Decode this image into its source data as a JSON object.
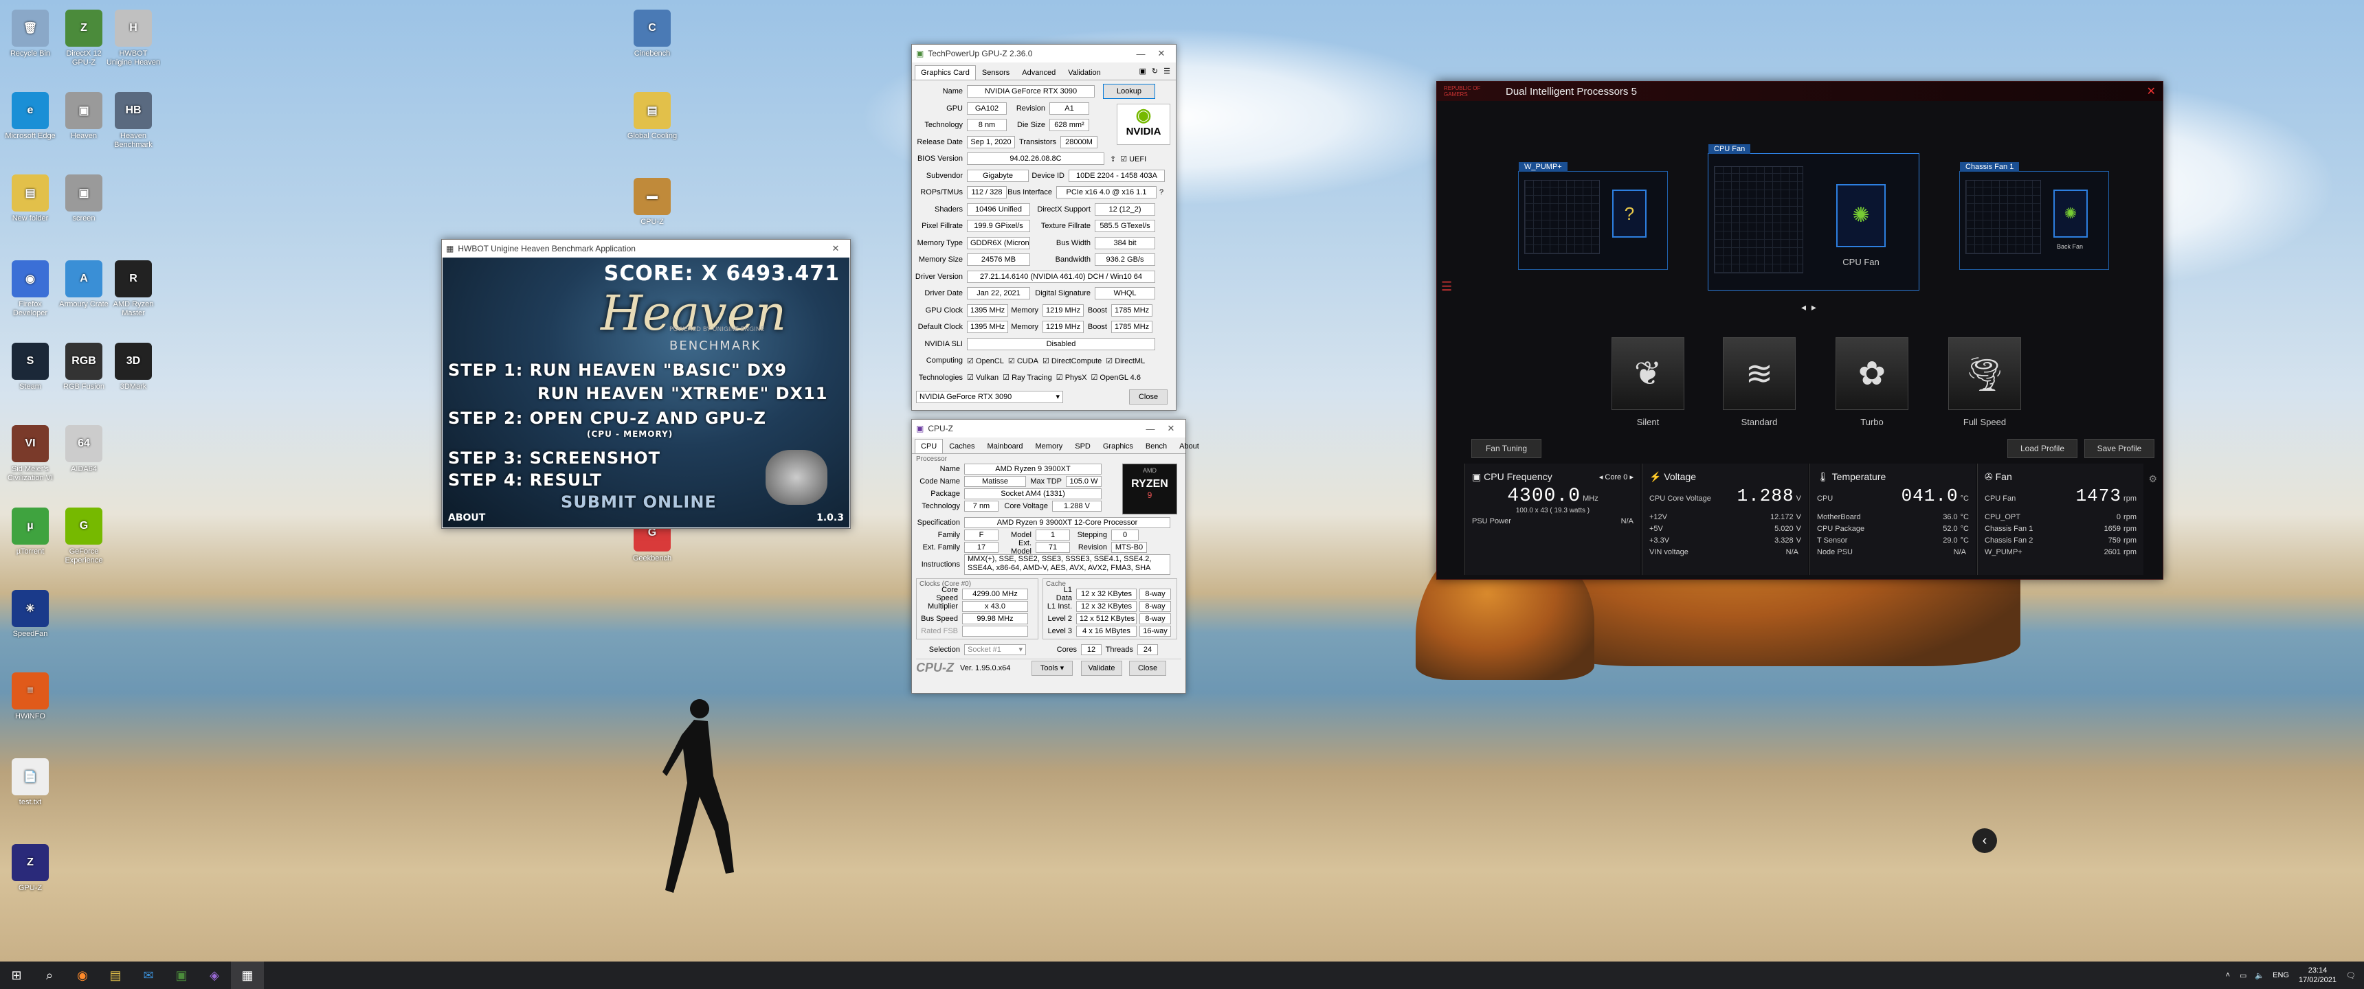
{
  "desktop": {
    "icons": [
      {
        "label": "Recycle Bin",
        "color": "#8aa8c8",
        "glyph": "🗑"
      },
      {
        "label": "DirectX 12 GPU-Z",
        "color": "#4b8b3b",
        "glyph": "Z"
      },
      {
        "label": "HWBOT Unigine Heaven",
        "color": "#c0c0c0",
        "glyph": "H"
      },
      {
        "label": "Microsoft Edge",
        "color": "#1a8fd6",
        "glyph": "e"
      },
      {
        "label": "Heaven",
        "color": "#9a9a9a",
        "glyph": "▣"
      },
      {
        "label": "Heaven Benchmark",
        "color": "#5a6a80",
        "glyph": "HB"
      },
      {
        "label": "New folder",
        "color": "#e2c04a",
        "glyph": "▤"
      },
      {
        "label": "screen",
        "color": "#9a9a9a",
        "glyph": "▣"
      },
      {
        "label": "Firefox Developer",
        "color": "#3b6fd6",
        "glyph": "◉"
      },
      {
        "label": "Armoury Crate",
        "color": "#3a8fd6",
        "glyph": "A"
      },
      {
        "label": "AMD Ryzen Master",
        "color": "#222",
        "glyph": "R"
      },
      {
        "label": "Steam",
        "color": "#1b2838",
        "glyph": "S"
      },
      {
        "label": "RGB Fusion",
        "color": "#333",
        "glyph": "RGB"
      },
      {
        "label": "3DMark",
        "color": "#222",
        "glyph": "3D"
      },
      {
        "label": "Sid Meier's Civilization VI",
        "color": "#7a3a2a",
        "glyph": "VI"
      },
      {
        "label": "AIDA64",
        "color": "#ccc",
        "glyph": "64"
      },
      {
        "label": "µTorrent",
        "color": "#3fa33f",
        "glyph": "µ"
      },
      {
        "label": "GeForce Experience",
        "color": "#76b900",
        "glyph": "G"
      },
      {
        "label": "SpeedFan",
        "color": "#1a3a8a",
        "glyph": "✳"
      },
      {
        "label": "HWiNFO",
        "color": "#e05a1a",
        "glyph": "≡"
      },
      {
        "label": "test.txt",
        "color": "#eee",
        "glyph": "📄"
      },
      {
        "label": "GPU-Z",
        "color": "#2a2a7a",
        "glyph": "Z"
      },
      {
        "label": "Cinebench",
        "color": "#4a7ab5",
        "glyph": "C"
      },
      {
        "label": "Global Cooling",
        "color": "#e2c04a",
        "glyph": "▤"
      },
      {
        "label": "CPU-Z",
        "color": "#c08a3a",
        "glyph": "▬"
      },
      {
        "label": "Geekbench",
        "color": "#d93a3a",
        "glyph": "G"
      }
    ]
  },
  "heaven": {
    "title": "HWBOT Unigine Heaven Benchmark Application",
    "score": "SCORE: X 6493.471",
    "logo": "Heaven",
    "benchmark": "BENCHMARK",
    "powered": "POWERED BY UNIGINE ENGINE",
    "steps": [
      "STEP 1:  RUN HEAVEN \"BASIC\" DX9",
      "RUN HEAVEN \"XTREME\" DX11",
      "STEP 2: OPEN CPU-Z  AND  GPU-Z",
      "(CPU - MEMORY)",
      "STEP 3:  SCREENSHOT",
      "STEP 4:   RESULT",
      "SUBMIT ONLINE"
    ],
    "about": "ABOUT",
    "version": "1.0.3"
  },
  "gpuz": {
    "title": "TechPowerUp GPU-Z 2.36.0",
    "tabs": [
      "Graphics Card",
      "Sensors",
      "Advanced",
      "Validation"
    ],
    "lookup": "Lookup",
    "vendor": "NVIDIA",
    "rows": {
      "name": {
        "l": "Name",
        "v": "NVIDIA GeForce RTX 3090"
      },
      "gpu": {
        "l": "GPU",
        "v": "GA102",
        "l2": "Revision",
        "v2": "A1"
      },
      "tech": {
        "l": "Technology",
        "v": "8 nm",
        "l2": "Die Size",
        "v2": "628 mm²"
      },
      "release": {
        "l": "Release Date",
        "v": "Sep 1, 2020",
        "l2": "Transistors",
        "v2": "28000M"
      },
      "bios": {
        "l": "BIOS Version",
        "v": "94.02.26.08.8C",
        "uefi": "UEFI"
      },
      "sub": {
        "l": "Subvendor",
        "v": "Gigabyte",
        "l2": "Device ID",
        "v2": "10DE 2204 - 1458 403A"
      },
      "rops": {
        "l": "ROPs/TMUs",
        "v": "112 / 328",
        "l2": "Bus Interface",
        "v2": "PCIe x16 4.0 @ x16 1.1",
        "q": "?"
      },
      "shaders": {
        "l": "Shaders",
        "v": "10496 Unified",
        "l2": "DirectX Support",
        "v2": "12 (12_2)"
      },
      "pixel": {
        "l": "Pixel Fillrate",
        "v": "199.9 GPixel/s",
        "l2": "Texture Fillrate",
        "v2": "585.5 GTexel/s"
      },
      "memtype": {
        "l": "Memory Type",
        "v": "GDDR6X (Micron)",
        "l2": "Bus Width",
        "v2": "384 bit"
      },
      "memsize": {
        "l": "Memory Size",
        "v": "24576 MB",
        "l2": "Bandwidth",
        "v2": "936.2 GB/s"
      },
      "driver": {
        "l": "Driver Version",
        "v": "27.21.14.6140 (NVIDIA 461.40) DCH / Win10 64"
      },
      "ddate": {
        "l": "Driver Date",
        "v": "Jan 22, 2021",
        "l2": "Digital Signature",
        "v2": "WHQL"
      },
      "gpuclock": {
        "l": "GPU Clock",
        "v": "1395 MHz",
        "l2": "Memory",
        "v2": "1219 MHz",
        "l3": "Boost",
        "v3": "1785 MHz"
      },
      "defclock": {
        "l": "Default Clock",
        "v": "1395 MHz",
        "l2": "Memory",
        "v2": "1219 MHz",
        "l3": "Boost",
        "v3": "1785 MHz"
      },
      "sli": {
        "l": "NVIDIA SLI",
        "v": "Disabled"
      }
    },
    "computing": {
      "l": "Computing",
      "items": [
        "OpenCL",
        "CUDA",
        "DirectCompute",
        "DirectML"
      ]
    },
    "technologies": {
      "l": "Technologies",
      "items": [
        "Vulkan",
        "Ray Tracing",
        "PhysX",
        "OpenGL 4.6"
      ]
    },
    "select": "NVIDIA GeForce RTX 3090",
    "close": "Close"
  },
  "cpuz": {
    "title": "CPU-Z",
    "tabs": [
      "CPU",
      "Caches",
      "Mainboard",
      "Memory",
      "SPD",
      "Graphics",
      "Bench",
      "About"
    ],
    "processor": "Processor",
    "name": {
      "l": "Name",
      "v": "AMD Ryzen 9 3900XT"
    },
    "codename": {
      "l": "Code Name",
      "v": "Matisse",
      "l2": "Max TDP",
      "v2": "105.0 W"
    },
    "package": {
      "l": "Package",
      "v": "Socket AM4 (1331)"
    },
    "tech": {
      "l": "Technology",
      "v": "7 nm",
      "l2": "Core Voltage",
      "v2": "1.288 V"
    },
    "spec": {
      "l": "Specification",
      "v": "AMD Ryzen 9 3900XT 12-Core Processor"
    },
    "family": {
      "l": "Family",
      "v": "F",
      "l2": "Model",
      "v2": "1",
      "l3": "Stepping",
      "v3": "0"
    },
    "extfam": {
      "l": "Ext. Family",
      "v": "17",
      "l2": "Ext. Model",
      "v2": "71",
      "l3": "Revision",
      "v3": "MTS-B0"
    },
    "instr": {
      "l": "Instructions",
      "v": "MMX(+), SSE, SSE2, SSE3, SSSE3, SSE4.1, SSE4.2, SSE4A, x86-64, AMD-V, AES, AVX, AVX2, FMA3, SHA"
    },
    "clocks": "Clocks (Core #0)",
    "cache": "Cache",
    "corespeed": {
      "l": "Core Speed",
      "v": "4299.00 MHz"
    },
    "mult": {
      "l": "Multiplier",
      "v": "x 43.0"
    },
    "bus": {
      "l": "Bus Speed",
      "v": "99.98 MHz"
    },
    "fsb": {
      "l": "Rated FSB",
      "v": ""
    },
    "l1d": {
      "l": "L1 Data",
      "v": "12 x 32 KBytes",
      "w": "8-way"
    },
    "l1i": {
      "l": "L1 Inst.",
      "v": "12 x 32 KBytes",
      "w": "8-way"
    },
    "l2": {
      "l": "Level 2",
      "v": "12 x 512 KBytes",
      "w": "8-way"
    },
    "l3": {
      "l": "Level 3",
      "v": "4 x 16 MBytes",
      "w": "16-way"
    },
    "selection": {
      "l": "Selection",
      "v": "Socket #1"
    },
    "cores": {
      "l": "Cores",
      "v": "12"
    },
    "threads": {
      "l": "Threads",
      "v": "24"
    },
    "brand": "CPU-Z",
    "ver": "Ver. 1.95.0.x64",
    "tools": "Tools",
    "validate": "Validate",
    "close": "Close",
    "logo": "RYZEN",
    "logo_small": "AMD",
    "logo_sub": "9"
  },
  "dip": {
    "title": "Dual Intelligent Processors 5",
    "rog": "REPUBLIC OF GAMERS",
    "fans": {
      "left": "W_PUMP+",
      "center": "CPU Fan",
      "right": "Chassis Fan 1",
      "center_label": "CPU Fan",
      "right_label": "Back Fan"
    },
    "modes": [
      "Silent",
      "Standard",
      "Turbo",
      "Full Speed"
    ],
    "mode_icons": [
      "❦",
      "≋",
      "✿",
      "🌪"
    ],
    "fan_tuning": "Fan Tuning",
    "load_profile": "Load Profile",
    "save_profile": "Save Profile",
    "cpu": {
      "h": "CPU Frequency",
      "core": "Core 0",
      "big": "4300.0",
      "unit": "MHz",
      "sub": "100.0  x  43     ( 19.3 watts )",
      "psu": "PSU Power",
      "psu_v": "N/A"
    },
    "volt": {
      "h": "Voltage",
      "k": "CPU Core Voltage",
      "big": "1.288",
      "unit": "V",
      "rows": [
        [
          "+12V",
          "12.172",
          "V"
        ],
        [
          "+5V",
          "5.020",
          "V"
        ],
        [
          "+3.3V",
          "3.328",
          "V"
        ],
        [
          "VIN voltage",
          "N/A",
          ""
        ]
      ]
    },
    "temp": {
      "h": "Temperature",
      "k": "CPU",
      "big": "041.0",
      "unit": "°C",
      "rows": [
        [
          "MotherBoard",
          "36.0",
          "°C"
        ],
        [
          "CPU Package",
          "52.0",
          "°C"
        ],
        [
          "T Sensor",
          "29.0",
          "°C"
        ],
        [
          "Node PSU",
          "N/A",
          ""
        ]
      ]
    },
    "fan": {
      "h": "Fan",
      "k": "CPU Fan",
      "big": "1473",
      "unit": "rpm",
      "rows": [
        [
          "CPU_OPT",
          "0",
          "rpm"
        ],
        [
          "Chassis Fan 1",
          "1659",
          "rpm"
        ],
        [
          "Chassis Fan 2",
          "759",
          "rpm"
        ],
        [
          "W_PUMP+",
          "2601",
          "rpm"
        ]
      ]
    }
  },
  "taskbar": {
    "lang": "ENG",
    "time": "23:14",
    "date": "17/02/2021"
  }
}
